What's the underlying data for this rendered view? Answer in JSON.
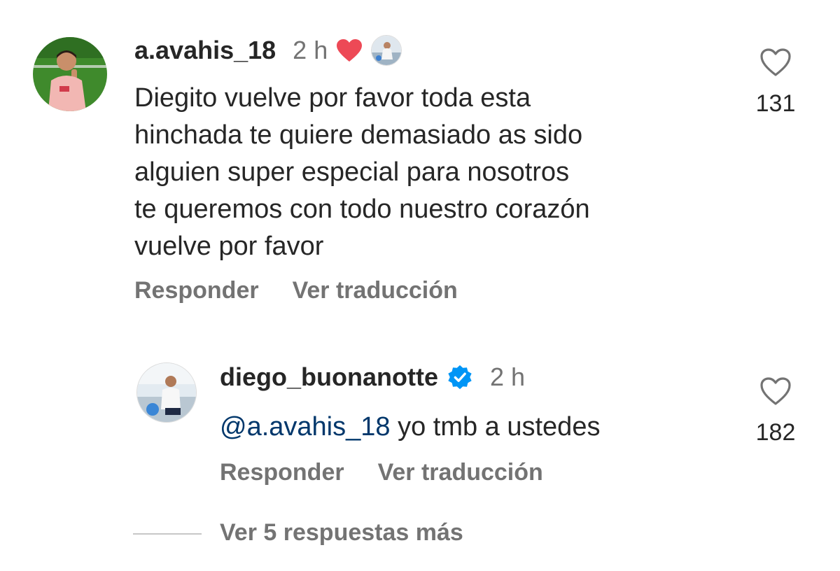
{
  "comment": {
    "username": "a.avahis_18",
    "time": "2 h",
    "text_lines": [
      "Diegito vuelve por favor toda esta",
      "hinchada te quiere demasiado as sido",
      "alguien super especial para nosotros",
      "te queremos con todo nuestro corazón",
      "vuelve por favor"
    ],
    "like_count": "131",
    "reply_label": "Responder",
    "translate_label": "Ver traducción",
    "heart_color": "#ed4956"
  },
  "reply": {
    "username": "diego_buonanotte",
    "verified_color": "#0095f6",
    "time": "2 h",
    "mention": "@a.avahis_18",
    "text": " yo tmb a ustedes",
    "like_count": "182",
    "reply_label": "Responder",
    "translate_label": "Ver traducción"
  },
  "more_replies_label": "Ver 5 respuestas más"
}
